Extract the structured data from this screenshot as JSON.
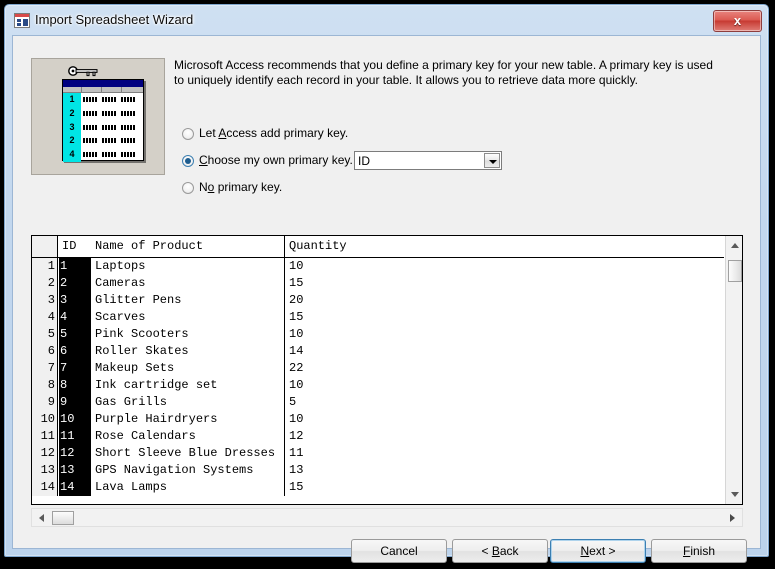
{
  "window": {
    "title": "Import Spreadsheet Wizard",
    "title_icon": "access-form-icon",
    "close_label": "x",
    "close_color": "#c73a32"
  },
  "illustration": {
    "key_icon": "primary-key-icon",
    "row_numbers": [
      "1",
      "2",
      "3",
      "2",
      "4"
    ],
    "header_color": "#000080",
    "key_column_color": "#00e5e5"
  },
  "instructions": "Microsoft Access recommends that you define a primary key for your new table. A primary key is used to uniquely identify each record in your table. It allows you to retrieve data more quickly.",
  "primary_key_options": [
    {
      "id": "let-access",
      "pre": "Let ",
      "acc": "A",
      "post": "ccess add primary key.",
      "selected": false
    },
    {
      "id": "choose-own",
      "pre": "",
      "acc": "C",
      "post": "hoose my own primary key.",
      "selected": true
    },
    {
      "id": "no-key",
      "pre": "N",
      "acc": "o",
      "post": " primary key.",
      "selected": false
    }
  ],
  "key_field_combo": {
    "value": "ID",
    "arrow_icon": "chevron-down-icon"
  },
  "grid": {
    "columns": [
      "ID",
      "Name of Product",
      "Quantity"
    ],
    "rows": [
      {
        "n": "1",
        "id": "1",
        "name": "Laptops",
        "qty": "10"
      },
      {
        "n": "2",
        "id": "2",
        "name": "Cameras",
        "qty": "15"
      },
      {
        "n": "3",
        "id": "3",
        "name": "Glitter Pens",
        "qty": "20"
      },
      {
        "n": "4",
        "id": "4",
        "name": "Scarves",
        "qty": "15"
      },
      {
        "n": "5",
        "id": "5",
        "name": "Pink Scooters",
        "qty": "10"
      },
      {
        "n": "6",
        "id": "6",
        "name": "Roller Skates",
        "qty": "14"
      },
      {
        "n": "7",
        "id": "7",
        "name": "Makeup Sets",
        "qty": "22"
      },
      {
        "n": "8",
        "id": "8",
        "name": "Ink cartridge set",
        "qty": "10"
      },
      {
        "n": "9",
        "id": "9",
        "name": "Gas Grills",
        "qty": "5"
      },
      {
        "n": "10",
        "id": "10",
        "name": "Purple Hairdryers",
        "qty": "10"
      },
      {
        "n": "11",
        "id": "11",
        "name": "Rose Calendars",
        "qty": "12"
      },
      {
        "n": "12",
        "id": "12",
        "name": "Short Sleeve Blue Dresses",
        "qty": "11"
      },
      {
        "n": "13",
        "id": "13",
        "name": "GPS Navigation Systems",
        "qty": "13"
      },
      {
        "n": "14",
        "id": "14",
        "name": "Lava Lamps",
        "qty": "15"
      }
    ],
    "selected_column": "ID",
    "selected_column_color": "#000000"
  },
  "scrollbars": {
    "v_up_icon": "scroll-up-arrow-icon",
    "v_down_icon": "scroll-down-arrow-icon",
    "h_left_icon": "scroll-left-arrow-icon",
    "h_right_icon": "scroll-right-arrow-icon"
  },
  "buttons": {
    "cancel": {
      "pre": "Cancel",
      "acc": "",
      "post": ""
    },
    "back": {
      "pre": "< ",
      "acc": "B",
      "post": "ack"
    },
    "next": {
      "pre": "",
      "acc": "N",
      "post": "ext >",
      "default": true
    },
    "finish": {
      "pre": "",
      "acc": "F",
      "post": "inish"
    }
  }
}
